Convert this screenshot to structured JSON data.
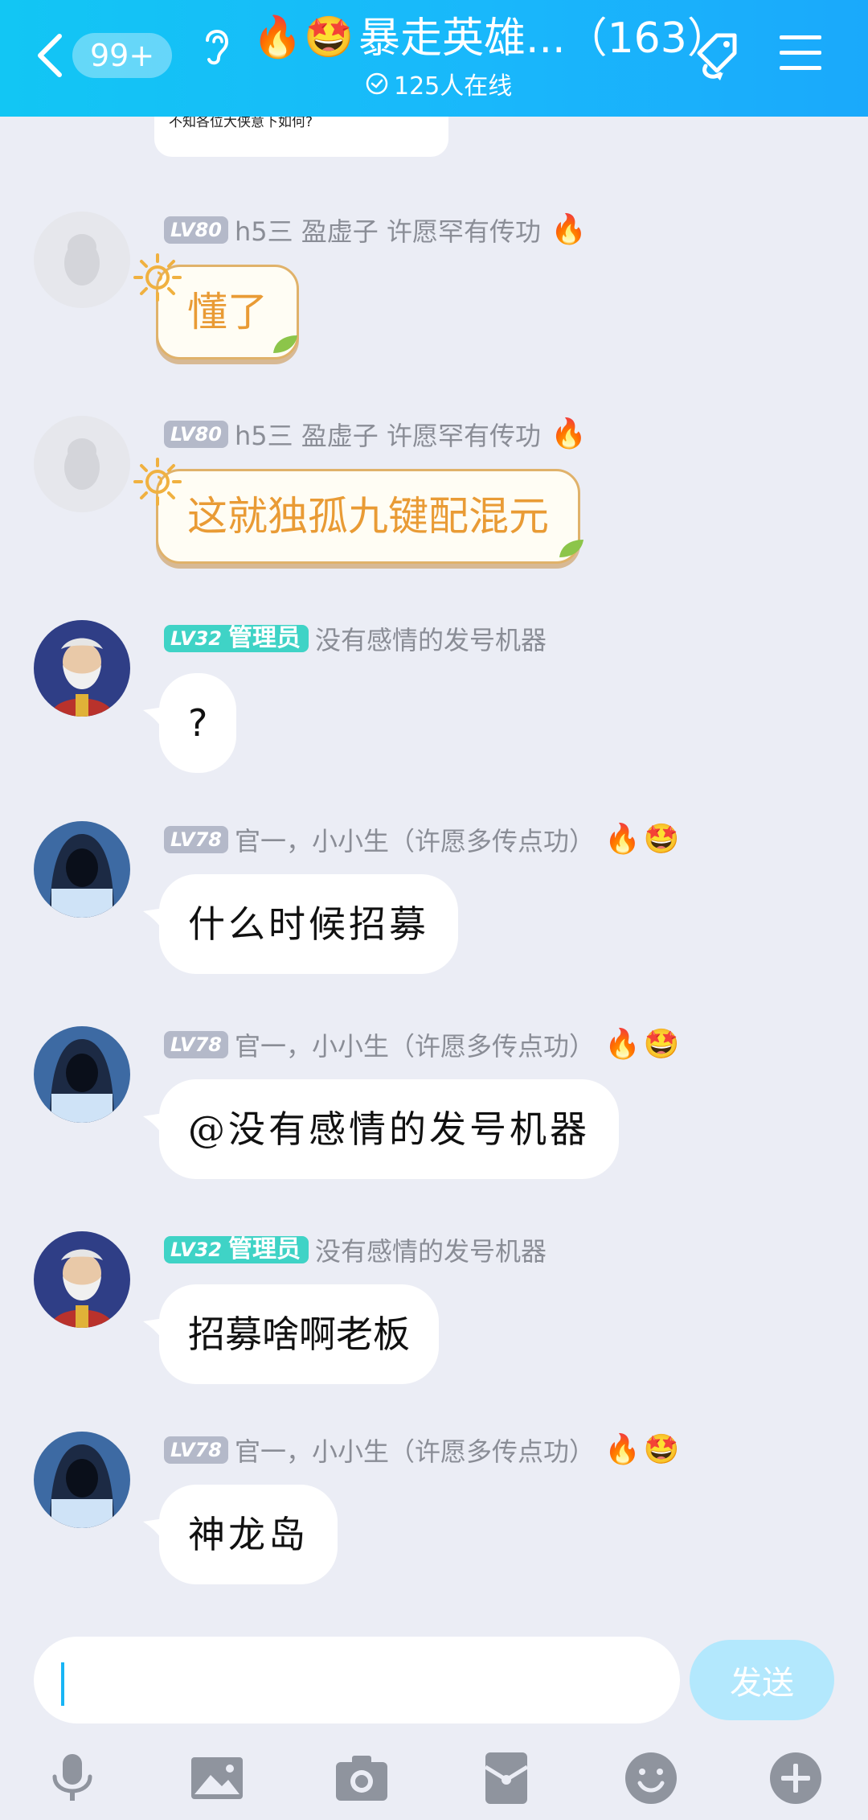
{
  "header": {
    "unread": "99+",
    "title": "暴走英雄...（163）",
    "online": "125人在线",
    "title_icons": [
      "fire-icon",
      "smile-icon"
    ],
    "colors": {
      "bar": "#19b8fb",
      "accent": "#3fd3c6"
    }
  },
  "previous_message": {
    "text": "不知各位大侠意下如何?"
  },
  "messages": [
    {
      "level": "LV80",
      "nickname": "h5三 盈虚子 许愿罕有传功",
      "text": "懂了",
      "style": "fancy",
      "tag": "🔥"
    },
    {
      "level": "LV80",
      "nickname": "h5三 盈虚子 许愿罕有传功",
      "text": "这就独孤九键配混元",
      "style": "fancy",
      "tag": "🔥"
    },
    {
      "level": "LV32",
      "role": "管理员",
      "nickname": "没有感情的发号机器",
      "text": "?"
    },
    {
      "level": "LV78",
      "nickname": "官一，小小生（许愿多传点功）",
      "text": "什么时候招募",
      "tag": "🔥",
      "tag2": "🤩"
    },
    {
      "level": "LV78",
      "nickname": "官一，小小生（许愿多传点功）",
      "text": "@没有感情的发号机器",
      "tag": "🔥",
      "tag2": "🤩"
    },
    {
      "level": "LV32",
      "role": "管理员",
      "nickname": "没有感情的发号机器",
      "text": "招募啥啊老板"
    },
    {
      "level": "LV78",
      "nickname": "官一，小小生（许愿多传点功）",
      "text": "神龙岛",
      "tag": "🔥",
      "tag2": "🤩"
    }
  ],
  "composer": {
    "value": "",
    "send_label": "发送"
  },
  "toolbar": [
    "microphone-icon",
    "image-icon",
    "camera-icon",
    "red-packet-icon",
    "emoji-icon",
    "plus-icon"
  ]
}
